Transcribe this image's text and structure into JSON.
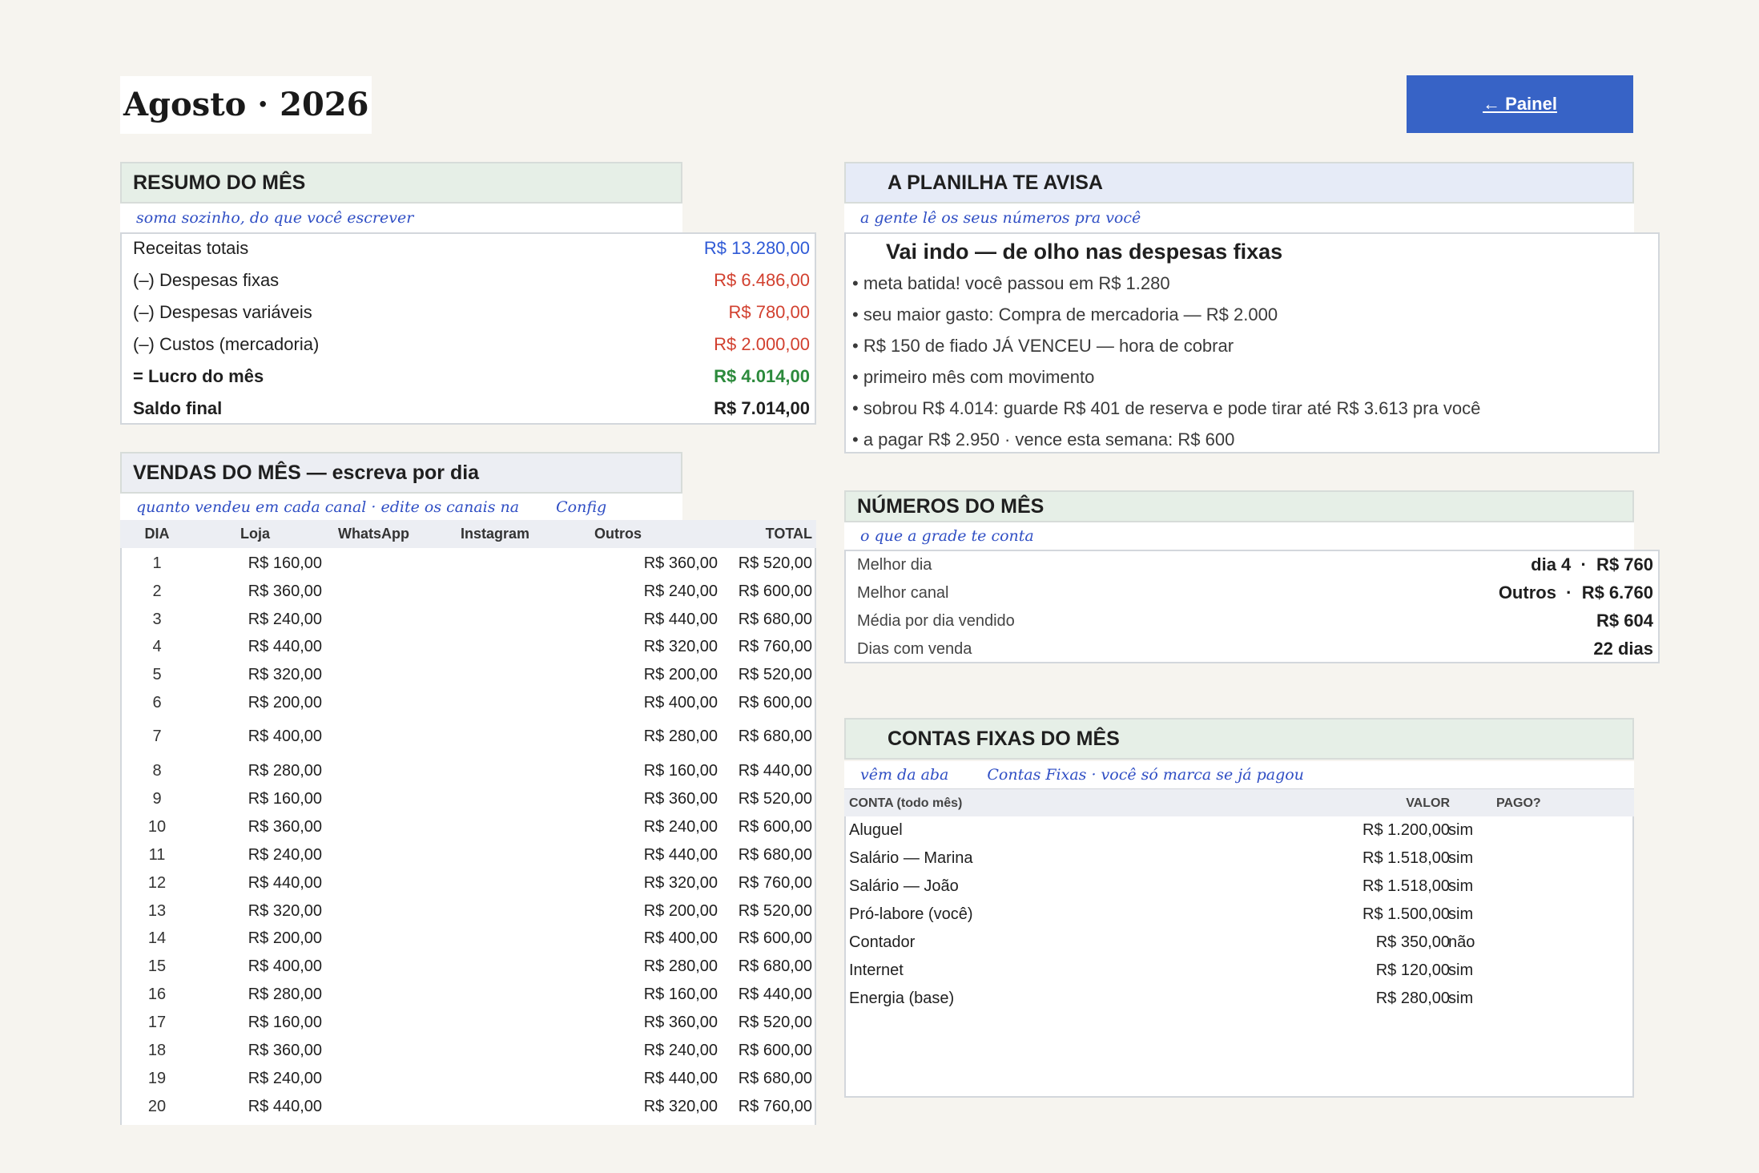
{
  "header": {
    "title": "Agosto · 2026",
    "painel_button": "← Painel"
  },
  "resumo": {
    "title": "RESUMO DO MÊS",
    "hint": "soma sozinho, do que você escrever",
    "rows": [
      {
        "label": "Receitas totais",
        "value": "R$ 13.280,00",
        "color": "#2f5ad6"
      },
      {
        "label": "(–) Despesas fixas",
        "value": "R$ 6.486,00",
        "color": "#d2402f"
      },
      {
        "label": "(–) Despesas variáveis",
        "value": "R$ 780,00",
        "color": "#d2402f"
      },
      {
        "label": "(–) Custos (mercadoria)",
        "value": "R$ 2.000,00",
        "color": "#d2402f"
      },
      {
        "label": "= Lucro do mês",
        "value": "R$ 4.014,00",
        "color": "#2c8a3c"
      },
      {
        "label": "Saldo final",
        "value": "R$ 7.014,00",
        "color": "#1f1f1f"
      }
    ]
  },
  "vendas": {
    "title": "VENDAS DO MÊS — escreva por dia",
    "hint_1": "quanto vendeu em cada canal · edite os canais na",
    "hint_link": "Config",
    "columns": [
      "DIA",
      "Loja",
      "WhatsApp",
      "Instagram",
      "Outros",
      "TOTAL"
    ],
    "rows": [
      {
        "dia": "1",
        "loja": "R$ 160,00",
        "outros": "R$ 360,00",
        "total": "R$ 520,00"
      },
      {
        "dia": "2",
        "loja": "R$ 360,00",
        "outros": "R$ 240,00",
        "total": "R$ 600,00"
      },
      {
        "dia": "3",
        "loja": "R$ 240,00",
        "outros": "R$ 440,00",
        "total": "R$ 680,00"
      },
      {
        "dia": "4",
        "loja": "R$ 440,00",
        "outros": "R$ 320,00",
        "total": "R$ 760,00"
      },
      {
        "dia": "5",
        "loja": "R$ 320,00",
        "outros": "R$ 200,00",
        "total": "R$ 520,00"
      },
      {
        "dia": "6",
        "loja": "R$ 200,00",
        "outros": "R$ 400,00",
        "total": "R$ 600,00"
      },
      {
        "dia": "7",
        "loja": "R$ 400,00",
        "outros": "R$ 280,00",
        "total": "R$ 680,00"
      },
      {
        "dia": "8",
        "loja": "R$ 280,00",
        "outros": "R$ 160,00",
        "total": "R$ 440,00"
      },
      {
        "dia": "9",
        "loja": "R$ 160,00",
        "outros": "R$ 360,00",
        "total": "R$ 520,00"
      },
      {
        "dia": "10",
        "loja": "R$ 360,00",
        "outros": "R$ 240,00",
        "total": "R$ 600,00"
      },
      {
        "dia": "11",
        "loja": "R$ 240,00",
        "outros": "R$ 440,00",
        "total": "R$ 680,00"
      },
      {
        "dia": "12",
        "loja": "R$ 440,00",
        "outros": "R$ 320,00",
        "total": "R$ 760,00"
      },
      {
        "dia": "13",
        "loja": "R$ 320,00",
        "outros": "R$ 200,00",
        "total": "R$ 520,00"
      },
      {
        "dia": "14",
        "loja": "R$ 200,00",
        "outros": "R$ 400,00",
        "total": "R$ 600,00"
      },
      {
        "dia": "15",
        "loja": "R$ 400,00",
        "outros": "R$ 280,00",
        "total": "R$ 680,00"
      },
      {
        "dia": "16",
        "loja": "R$ 280,00",
        "outros": "R$ 160,00",
        "total": "R$ 440,00"
      },
      {
        "dia": "17",
        "loja": "R$ 160,00",
        "outros": "R$ 360,00",
        "total": "R$ 520,00"
      },
      {
        "dia": "18",
        "loja": "R$ 360,00",
        "outros": "R$ 240,00",
        "total": "R$ 600,00"
      },
      {
        "dia": "19",
        "loja": "R$ 240,00",
        "outros": "R$ 440,00",
        "total": "R$ 680,00"
      },
      {
        "dia": "20",
        "loja": "R$ 440,00",
        "outros": "R$ 320,00",
        "total": "R$ 760,00"
      }
    ]
  },
  "avisa": {
    "title": "A PLANILHA TE AVISA",
    "hint": "a gente lê os seus números pra você",
    "headline": "Vai indo — de olho nas despesas fixas",
    "items": [
      "• meta batida!      você passou em R$ 1.280",
      "• seu maior gasto: Compra de mercadoria — R$ 2.000",
      "• R$ 150 de fiado JÁ VENCEU — hora de cobrar",
      "• primeiro mês com movimento",
      "• sobrou R$ 4.014: guarde R$ 401 de reserva e pode tirar até R$ 3.613 pra você",
      "• a pagar R$ 2.950   ·   vence esta semana: R$ 600"
    ]
  },
  "numeros": {
    "title": "NÚMEROS DO MÊS",
    "hint": "o que a grade te conta",
    "rows": [
      {
        "label": "Melhor dia",
        "value": "dia 4  ·  R$ 760"
      },
      {
        "label": "Melhor canal",
        "value": "Outros  ·  R$ 6.760"
      },
      {
        "label": "Média por dia vendido",
        "value": "R$ 604"
      },
      {
        "label": "Dias com venda",
        "value": "22 dias"
      }
    ]
  },
  "contas": {
    "title": "CONTAS FIXAS DO MÊS",
    "hint_1": "vêm da aba",
    "hint_2": "Contas Fixas · você só marca se já pagou",
    "columns": [
      "CONTA (todo mês)",
      "VALOR",
      "PAGO?"
    ],
    "rows": [
      {
        "conta": "Aluguel",
        "valor": "R$ 1.200,00",
        "pago": "sim"
      },
      {
        "conta": "Salário — Marina",
        "valor": "R$ 1.518,00",
        "pago": "sim"
      },
      {
        "conta": "Salário — João",
        "valor": "R$ 1.518,00",
        "pago": "sim"
      },
      {
        "conta": "Pró-labore (você)",
        "valor": "R$ 1.500,00",
        "pago": "sim"
      },
      {
        "conta": "Contador",
        "valor": "R$ 350,00",
        "pago": "não"
      },
      {
        "conta": "Internet",
        "valor": "R$ 120,00",
        "pago": "sim"
      },
      {
        "conta": "Energia (base)",
        "valor": "R$ 280,00",
        "pago": "sim"
      }
    ]
  }
}
